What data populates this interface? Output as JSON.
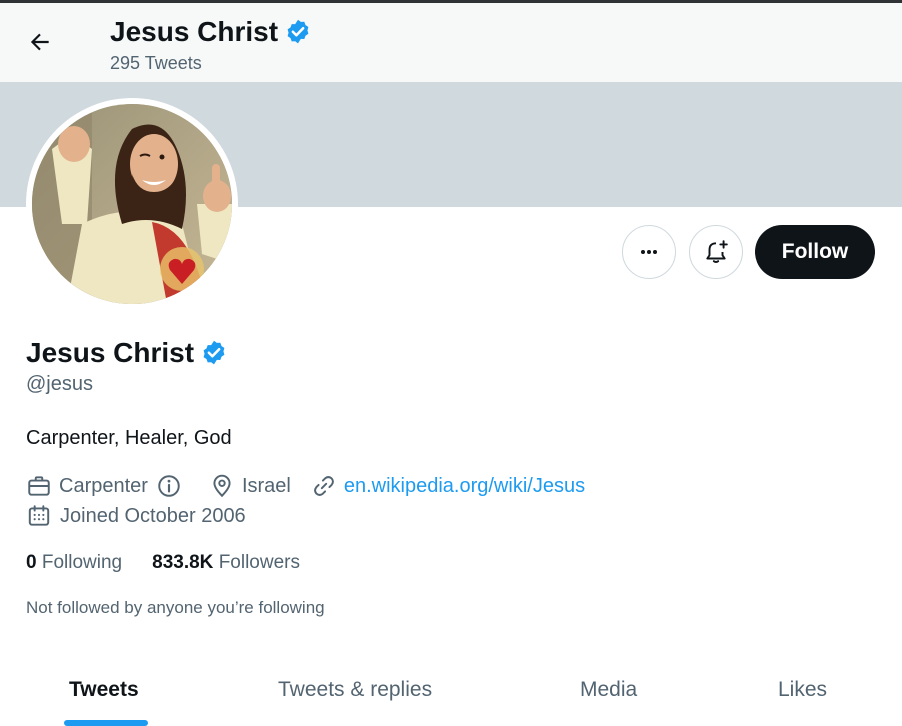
{
  "header": {
    "name": "Jesus Christ",
    "tweet_count": "295 Tweets"
  },
  "profile": {
    "display_name": "Jesus Christ",
    "handle": "@jesus",
    "bio": "Carpenter, Healer, God",
    "occupation": "Carpenter",
    "location": "Israel",
    "website": "en.wikipedia.org/wiki/Jesus",
    "joined": "Joined October 2006"
  },
  "actions": {
    "follow_label": "Follow"
  },
  "stats": {
    "following_count": "0",
    "following_label": "Following",
    "followers_count": "833.8K",
    "followers_label": "Followers"
  },
  "social_context": "Not followed by anyone you’re following",
  "tabs": [
    {
      "label": "Tweets",
      "active": true
    },
    {
      "label": "Tweets & replies",
      "active": false
    },
    {
      "label": "Media",
      "active": false
    },
    {
      "label": "Likes",
      "active": false
    }
  ],
  "colors": {
    "accent": "#1d9bf0",
    "banner": "#cfd9de",
    "text_primary": "#0f1419",
    "text_secondary": "#536471",
    "follow_button": "#0f1419"
  },
  "icons": {
    "back": "arrow-left-icon",
    "verified": "verified-badge-icon",
    "more": "more-horizontal-icon",
    "notify": "bell-plus-icon",
    "occupation": "briefcase-icon",
    "info": "info-icon",
    "location": "location-pin-icon",
    "link": "link-icon",
    "calendar": "calendar-icon"
  }
}
